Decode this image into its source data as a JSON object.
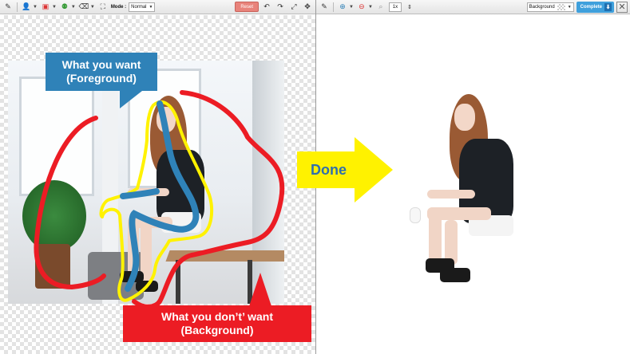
{
  "left_toolbar": {
    "mode_label": "Mode :",
    "mode_value": "Normal",
    "reset_label": "Reset"
  },
  "right_toolbar": {
    "zoom_value": "1x",
    "background_label": "Background",
    "complete_label": "Complete"
  },
  "annotations": {
    "foreground_line1": "What you want",
    "foreground_line2": "(Foreground)",
    "background_line1": "What you don’t’ want",
    "background_line2": "(Background)",
    "done_label": "Done"
  },
  "colors": {
    "foreground_stroke": "#2f82b8",
    "background_stroke": "#ec1c24",
    "outline": "#fff200",
    "done_arrow": "#fff200"
  }
}
